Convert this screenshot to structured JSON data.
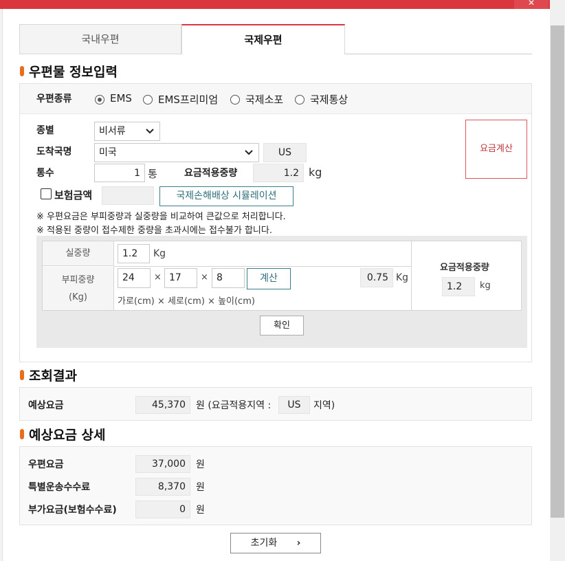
{
  "window": {
    "close_glyph": "✕"
  },
  "tabs": [
    {
      "label": "국내우편",
      "active": false
    },
    {
      "label": "국제우편",
      "active": true
    }
  ],
  "info_section": {
    "title": "우편물 정보입력",
    "mail_type_label": "우편종류",
    "mail_types": [
      {
        "label": "EMS",
        "selected": true
      },
      {
        "label": "EMS프리미엄",
        "selected": false
      },
      {
        "label": "국제소포",
        "selected": false
      },
      {
        "label": "국제통상",
        "selected": false
      }
    ],
    "category_label": "종별",
    "category_value": "비서류",
    "country_label": "도착국명",
    "country_value": "미국",
    "country_code": "US",
    "count_label": "통수",
    "count_value": "1",
    "count_unit": "통",
    "applied_weight_label": "요금적용중량",
    "applied_weight_value": "1.2",
    "weight_unit": "kg",
    "insurance_label": "보험금액",
    "insurance_value": "",
    "simulation_button": "국제손해배상 시뮬레이션",
    "calc_fee_button": "요금계산",
    "notes": [
      "※ 우편요금은 부피중량과 실중량을 비교하여 큰값으로 처리합니다.",
      "※ 적용된 중량이 접수제한 중량을 초과시에는 접수불가 합니다."
    ],
    "weight_table": {
      "actual_label": "실중량",
      "actual_value": "1.2",
      "actual_unit": "Kg",
      "volume_label": "부피중량",
      "volume_sub_label": "(Kg)",
      "dims": [
        "24",
        "17",
        "8"
      ],
      "times": "×",
      "calc_button": "계산",
      "volume_result": "0.75",
      "volume_unit": "Kg",
      "dims_hint": "가로(cm) × 세로(cm) × 높이(cm)",
      "applied_label": "요금적용중량",
      "applied_value": "1.2",
      "applied_unit": "kg",
      "confirm_button": "확인"
    }
  },
  "result_section": {
    "title": "조회결과",
    "estimate_label": "예상요금",
    "estimate_value": "45,370",
    "estimate_suffix": "원 (요금적용지역 :",
    "zone_value": "US",
    "zone_suffix": "지역)"
  },
  "detail_section": {
    "title": "예상요금 상세",
    "rows": [
      {
        "label": "우편요금",
        "value": "37,000",
        "unit": "원"
      },
      {
        "label": "특별운송수수료",
        "value": "8,370",
        "unit": "원"
      },
      {
        "label": "부가요금(보험수수료)",
        "value": "0",
        "unit": "원"
      }
    ]
  },
  "reset_button": {
    "label": "초기화",
    "arrow": "›"
  }
}
